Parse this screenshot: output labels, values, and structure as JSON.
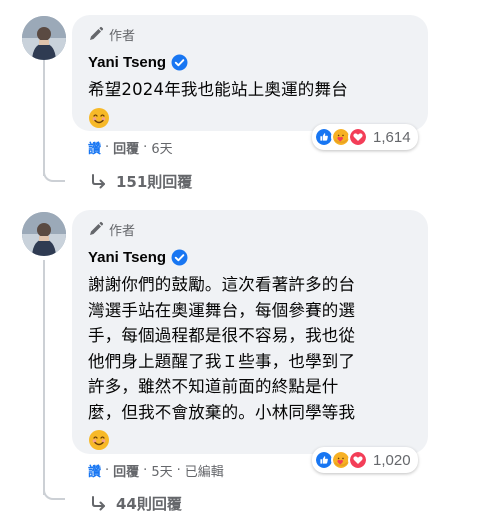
{
  "comments": [
    {
      "author_badge": "作者",
      "author_name": "Yani Tseng",
      "text": "希望2024年我也能站上奧運的舞台",
      "reaction_count": "1,614",
      "actions": {
        "like": "讚",
        "reply": "回覆",
        "time": "6天",
        "edited": ""
      },
      "replies_label": "151則回覆"
    },
    {
      "author_badge": "作者",
      "author_name": "Yani Tseng",
      "text": "謝謝你們的鼓勵。這次看著許多的台\n灣選手站在奧運舞台，每個參賽的選\n手，每個過程都是很不容易，我也從\n他們身上題醒了我Ｉ些事，也學到了\n許多，雖然不知道前面的終點是什\n麼，但我不會放棄的。小林同學等我",
      "reaction_count": "1,020",
      "actions": {
        "like": "讚",
        "reply": "回覆",
        "time": "5天",
        "edited": "已編輯"
      },
      "replies_label": "44則回覆"
    }
  ],
  "icons": {
    "author_badge": "pencil-icon",
    "verified": "verified-check-icon",
    "emoji": "smiling-face-emoji",
    "reactions": [
      "like-reaction-icon",
      "care-reaction-icon",
      "love-reaction-icon"
    ],
    "replies": "reply-arrow-icon"
  },
  "colors": {
    "bubble": "#f0f2f5",
    "like_blue": "#1876f2",
    "secondary_text": "#65676b",
    "love_red": "#f33e58",
    "care_yellow": "#f7b125"
  }
}
